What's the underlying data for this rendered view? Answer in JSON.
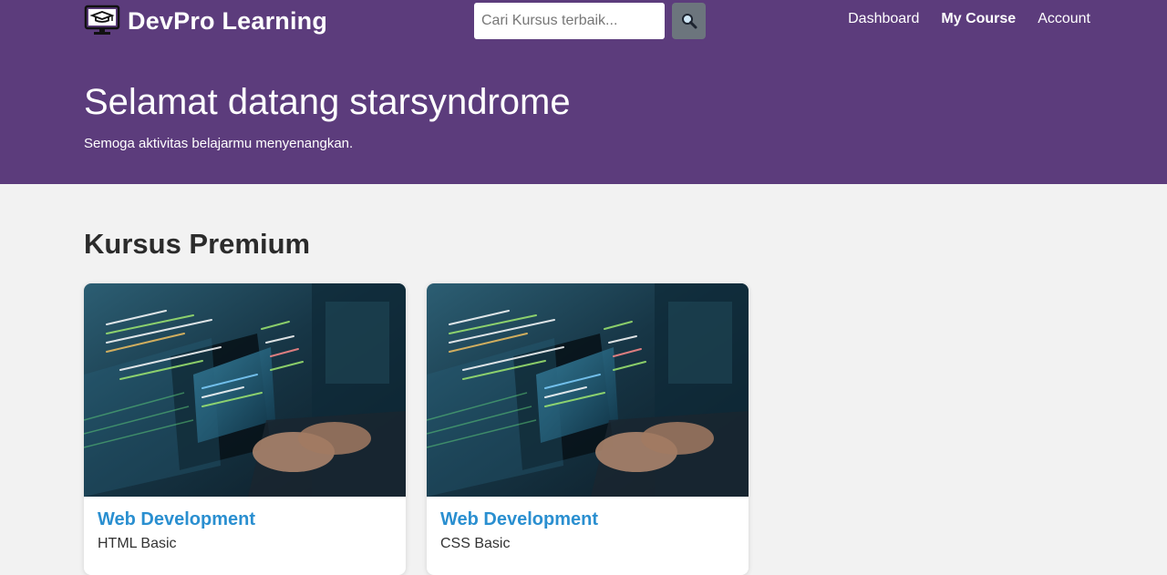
{
  "header": {
    "brand_name": "DevPro Learning",
    "brand_icon": "monitor-graduation-cap-icon",
    "search": {
      "placeholder": "Cari Kursus terbaik...",
      "value": ""
    },
    "search_icon": "magnifier-icon",
    "nav": [
      {
        "label": "Dashboard",
        "active": false
      },
      {
        "label": "My Course",
        "active": true
      },
      {
        "label": "Account",
        "active": false
      }
    ]
  },
  "hero": {
    "title": "Selamat datang starsyndrome",
    "subtitle": "Semoga aktivitas belajarmu menyenangkan."
  },
  "section": {
    "title": "Kursus Premium",
    "courses": [
      {
        "title": "Web Development",
        "subtitle": "HTML Basic",
        "image": "code-screen-photo"
      },
      {
        "title": "Web Development",
        "subtitle": "CSS Basic",
        "image": "code-screen-photo"
      }
    ]
  },
  "colors": {
    "header_bg": "#5c3c7c",
    "page_bg": "#f2f2f2",
    "course_title": "#2a8fd0",
    "search_button": "#6c757d"
  }
}
